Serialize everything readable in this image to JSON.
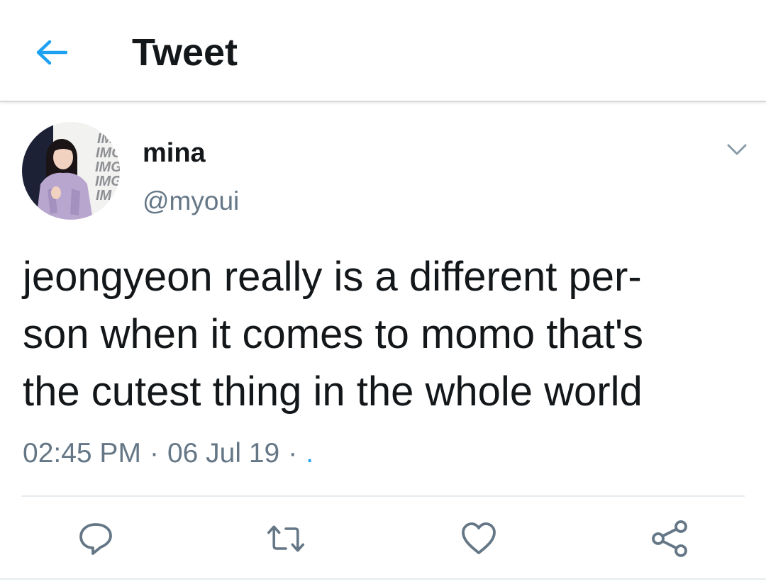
{
  "header": {
    "back_icon": "arrow-left-icon",
    "title": "Tweet"
  },
  "colors": {
    "accent": "#1da1f2",
    "text_primary": "#14171a",
    "text_secondary": "#657786",
    "icon_gray": "#657786",
    "divider": "#e6ecf0"
  },
  "tweet": {
    "author": {
      "display_name": "mina",
      "handle": "@myoui",
      "avatar_backdrop_text": [
        "IM",
        "IMG",
        "IMG",
        "IMG",
        "IM"
      ]
    },
    "more_icon": "chevron-down-icon",
    "text_lines": [
      "jeongyeon really is a different per-",
      "son when it comes to momo that's",
      "the cutest thing in the whole world"
    ],
    "time": "02:45 PM",
    "date": "06 Jul 19",
    "separator": "·",
    "source": "."
  },
  "actions": [
    {
      "name": "reply",
      "icon": "reply-icon"
    },
    {
      "name": "retweet",
      "icon": "retweet-icon"
    },
    {
      "name": "like",
      "icon": "heart-icon"
    },
    {
      "name": "share",
      "icon": "share-icon"
    }
  ]
}
